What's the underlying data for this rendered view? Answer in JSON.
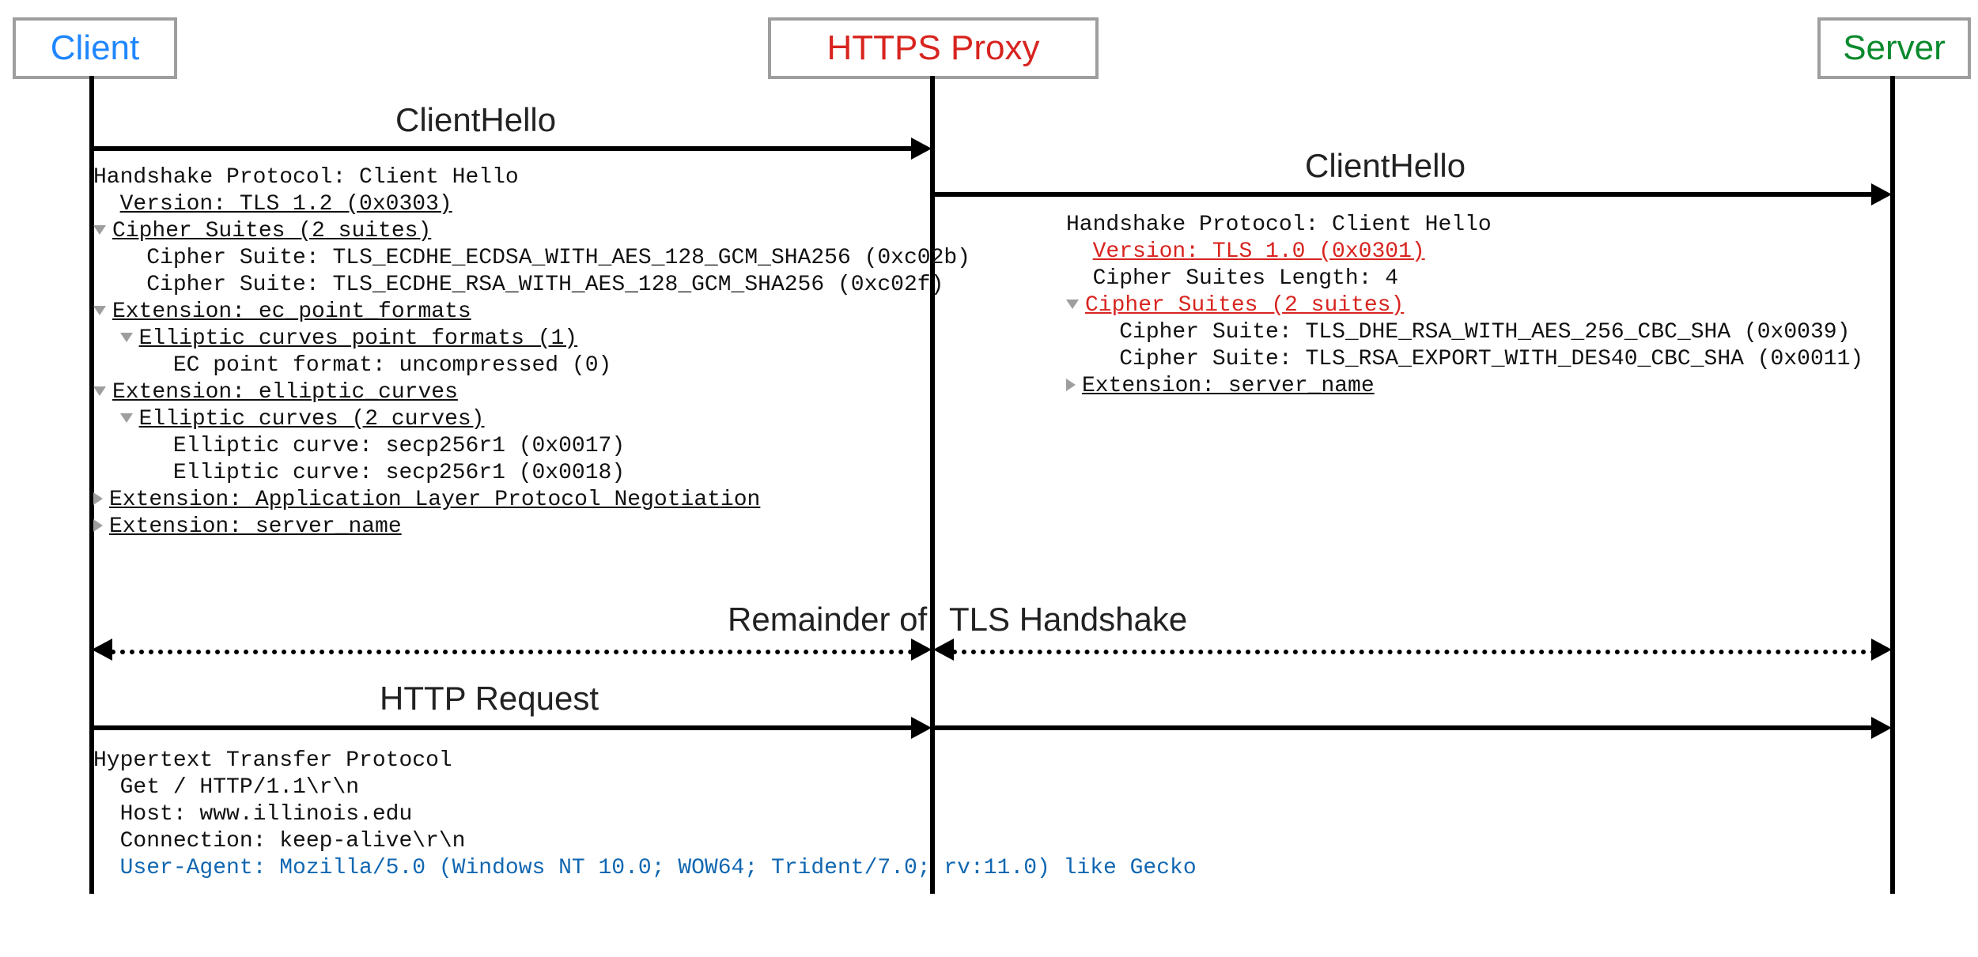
{
  "actors": {
    "client": "Client",
    "proxy": "HTTPS Proxy",
    "server": "Server"
  },
  "messages": {
    "clienthello_left": "ClientHello",
    "clienthello_right": "ClientHello",
    "remainder_left": "Remainder of",
    "remainder_right": "TLS Handshake",
    "http_request": "HTTP Request"
  },
  "left_dump": {
    "l0": "Handshake Protocol: Client Hello",
    "l1": "Version: TLS 1.2 (0x0303)",
    "l2": "Cipher Suites (2 suites)",
    "l3": "Cipher Suite: TLS_ECDHE_ECDSA_WITH_AES_128_GCM_SHA256 (0xc02b)",
    "l4": "Cipher Suite: TLS_ECDHE_RSA_WITH_AES_128_GCM_SHA256 (0xc02f)",
    "l5": "Extension: ec_point_formats",
    "l6": "Elliptic curves point formats (1)",
    "l7": "EC point format: uncompressed (0)",
    "l8": "Extension: elliptic_curves",
    "l9": "Elliptic curves (2 curves)",
    "l10": "Elliptic curve: secp256r1 (0x0017)",
    "l11": "Elliptic curve: secp256r1 (0x0018)",
    "l12": "Extension: Application Layer Protocol Negotiation",
    "l13": "Extension: server_name"
  },
  "right_dump": {
    "r0": "Handshake Protocol: Client Hello",
    "r1": "Version: TLS 1.0 (0x0301)",
    "r2": "Cipher Suites Length: 4",
    "r3": "Cipher Suites (2 suites)",
    "r4": "Cipher Suite: TLS_DHE_RSA_WITH_AES_256_CBC_SHA (0x0039)",
    "r5": "Cipher Suite: TLS_RSA_EXPORT_WITH_DES40_CBC_SHA (0x0011)",
    "r6": "Extension: server_name"
  },
  "http": {
    "h0": "Hypertext Transfer Protocol",
    "h1": "Get / HTTP/1.1\\r\\n",
    "h2": "Host: www.illinois.edu",
    "h3": "Connection: keep-alive\\r\\n",
    "h4": "User-Agent: Mozilla/5.0 (Windows NT 10.0; WOW64; Trident/7.0; rv:11.0) like Gecko"
  }
}
